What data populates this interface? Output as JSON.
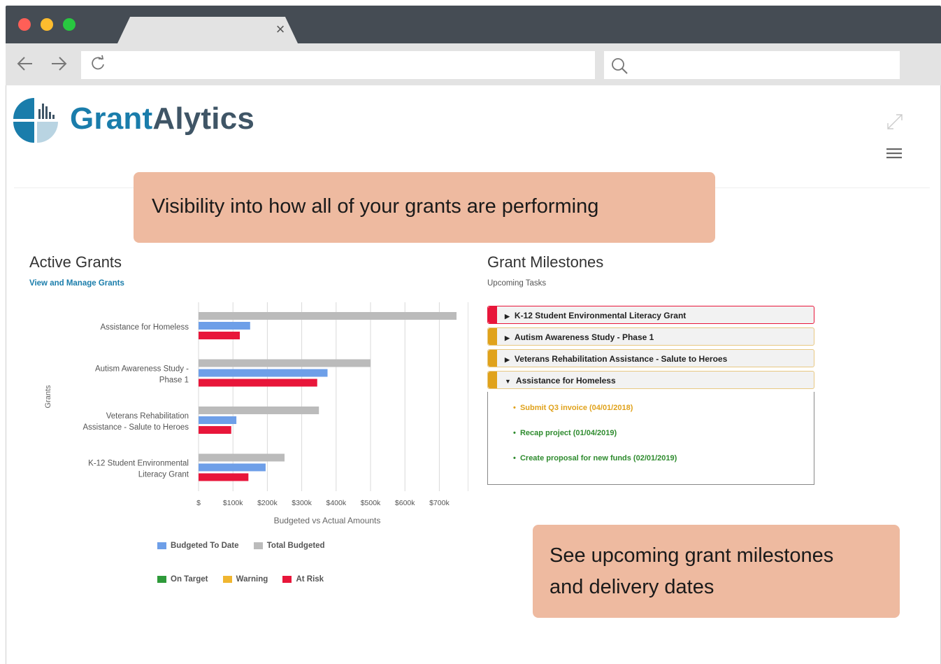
{
  "browser": {
    "tab_close": "×",
    "url": "",
    "search": "",
    "colors": {
      "chrome_dark": "#454c54",
      "chrome_light": "#e3e3e3",
      "dot_red": "#ff5f57",
      "dot_yellow": "#febc2e",
      "dot_green": "#28c840"
    }
  },
  "app": {
    "brand_part1": "Grant",
    "brand_part2": "Alytics",
    "colors": {
      "brand_blue": "#1a7dab",
      "brand_slate": "#3f5566",
      "callout": "#eebaa0"
    }
  },
  "callouts": {
    "top": "Visibility into how all of your grants are performing",
    "bottom_line1": "See upcoming grant milestones",
    "bottom_line2": "and delivery dates"
  },
  "active_grants": {
    "title": "Active Grants",
    "link": "View and Manage Grants"
  },
  "milestones": {
    "title": "Grant Milestones",
    "subtitle": "Upcoming Tasks",
    "items": [
      {
        "label": "K-12 Student Environmental Literacy Grant",
        "status": "At Risk",
        "color": "#e8163a",
        "expanded": false
      },
      {
        "label": "Autism Awareness Study - Phase 1",
        "status": "Warning",
        "color": "#e0a21b",
        "expanded": false
      },
      {
        "label": "Veterans Rehabilitation Assistance - Salute to Heroes",
        "status": "Warning",
        "color": "#e0a21b",
        "expanded": false
      },
      {
        "label": "Assistance for Homeless",
        "status": "Warning",
        "color": "#e0a21b",
        "expanded": true
      }
    ],
    "tasks": [
      {
        "text": "Submit Q3 invoice (04/01/2018)",
        "color": "#e0a21b"
      },
      {
        "text": "Recap project (01/04/2019)",
        "color": "#2e8b2e"
      },
      {
        "text": "Create proposal for new funds (02/01/2019)",
        "color": "#2e8b2e"
      }
    ]
  },
  "legend": {
    "budgeted_to_date": "Budgeted To Date",
    "total_budgeted": "Total Budgeted",
    "on_target": "On Target",
    "warning": "Warning",
    "at_risk": "At Risk",
    "colors": {
      "budgeted_to_date": "#6e9fe8",
      "total_budgeted": "#bbbbbb",
      "on_target": "#2e9a3a",
      "warning": "#f0b630",
      "at_risk": "#e8163a"
    }
  },
  "chart_data": {
    "type": "bar",
    "orientation": "horizontal",
    "categories": [
      "Assistance for Homeless",
      "Autism Awareness Study - Phase 1",
      "Veterans Rehabilitation Assistance - Salute to Heroes",
      "K-12 Student Environmental Literacy Grant"
    ],
    "category_label_lines": [
      [
        "Assistance for Homeless"
      ],
      [
        "Autism Awareness Study -",
        "Phase 1"
      ],
      [
        "Veterans Rehabilitation",
        "Assistance - Salute to Heroes"
      ],
      [
        "K-12 Student Environmental",
        "Literacy Grant"
      ]
    ],
    "series": [
      {
        "name": "Total Budgeted",
        "color": "#bbbbbb",
        "values": [
          750000,
          500000,
          350000,
          250000
        ]
      },
      {
        "name": "Budgeted To Date",
        "color": "#6e9fe8",
        "values": [
          150000,
          375000,
          110000,
          195000
        ]
      },
      {
        "name": "Actual",
        "colors": [
          "#e8163a",
          "#e8163a",
          "#e8163a",
          "#e8163a"
        ],
        "values": [
          120000,
          345000,
          95000,
          145000
        ]
      }
    ],
    "xlim": [
      0,
      750000
    ],
    "xticks": [
      "$",
      "$100k",
      "$200k",
      "$300k",
      "$400k",
      "$500k",
      "$600k",
      "$700k"
    ],
    "xlabel": "Budgeted vs Actual Amounts",
    "ylabel": "Grants",
    "grid": true
  }
}
